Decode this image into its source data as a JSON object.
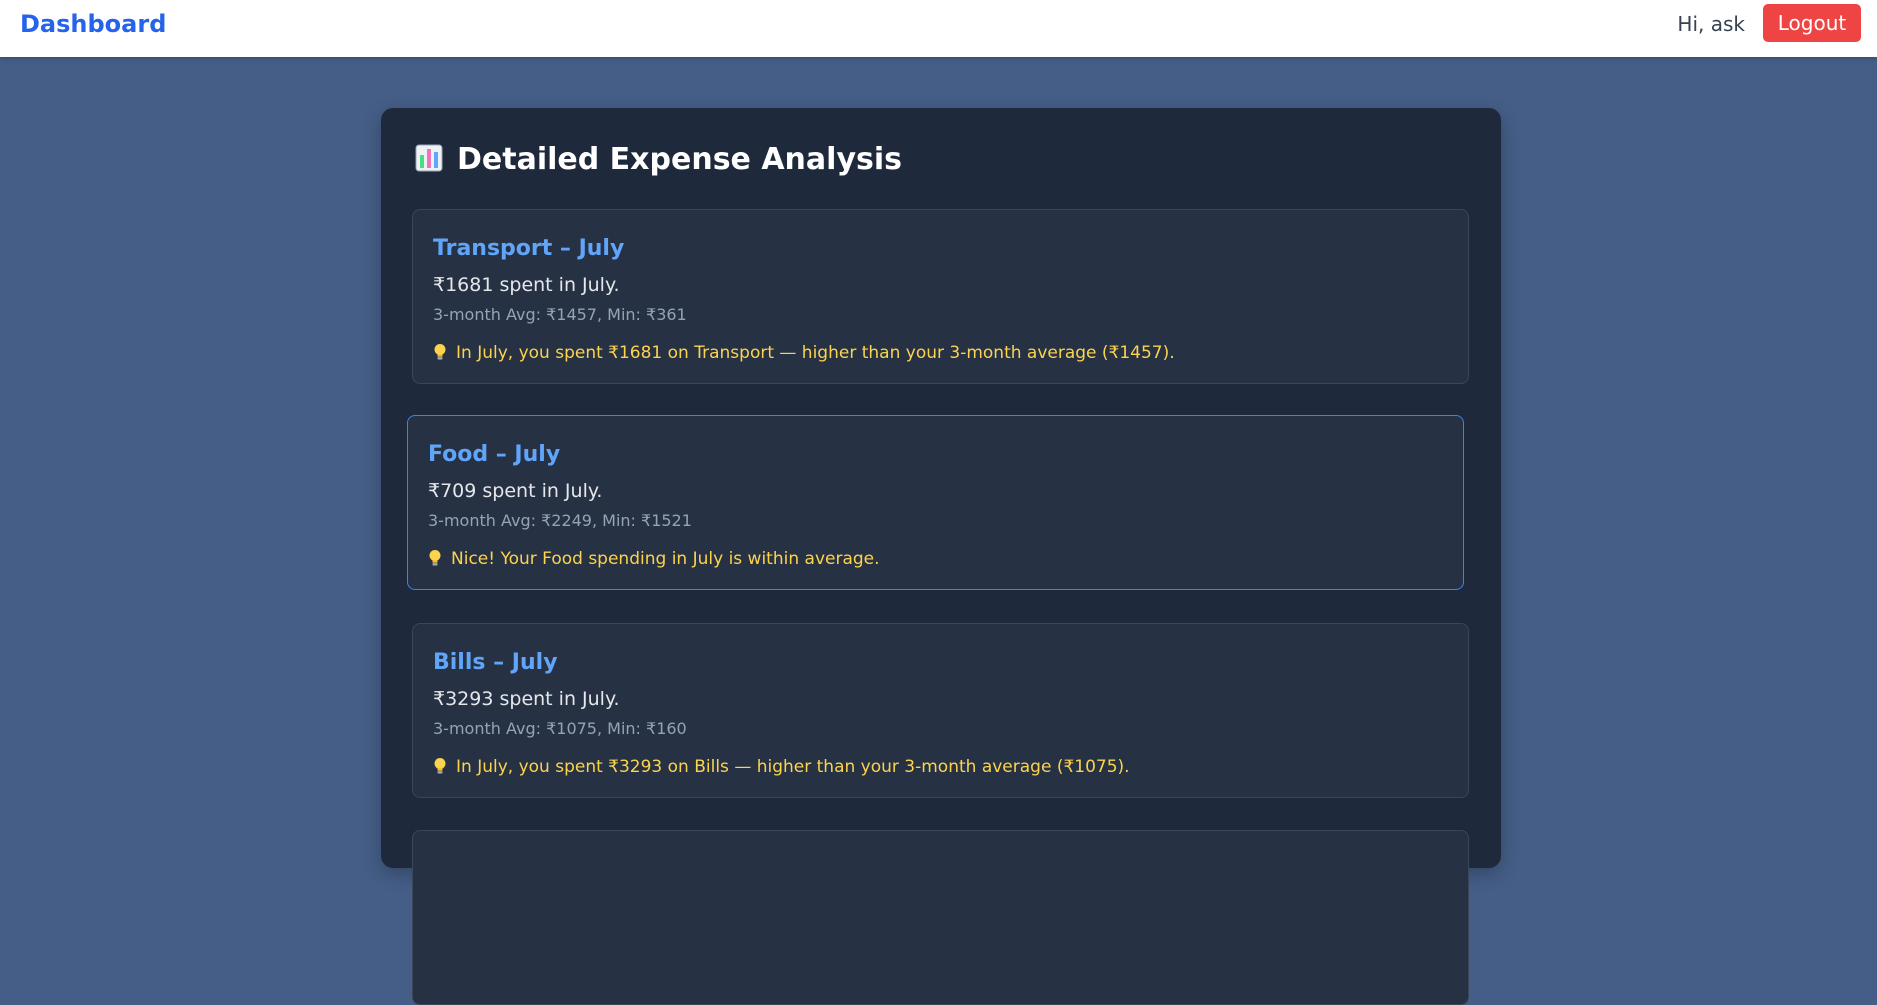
{
  "navbar": {
    "brand": "Dashboard",
    "greeting": "Hi, ask",
    "logout_label": "Logout"
  },
  "page": {
    "title_icon": "bar-chart-icon",
    "title": "Detailed Expense Analysis"
  },
  "cards": [
    {
      "title": "Transport – July",
      "spent": "₹1681 spent in July.",
      "stats": "3-month Avg: ₹1457, Min: ₹361",
      "insight_icon": "lightbulb-icon",
      "insight": "In July, you spent ₹1681 on Transport — higher than your 3-month average (₹1457)."
    },
    {
      "title": "Food – July",
      "spent": "₹709 spent in July.",
      "stats": "3-month Avg: ₹2249, Min: ₹1521",
      "insight_icon": "lightbulb-icon",
      "insight": "Nice! Your Food spending in July is within average."
    },
    {
      "title": "Bills – July",
      "spent": "₹3293 spent in July.",
      "stats": "3-month Avg: ₹1075, Min: ₹160",
      "insight_icon": "lightbulb-icon",
      "insight": "In July, you spent ₹3293 on Bills — higher than your 3-month average (₹1075)."
    }
  ],
  "colors": {
    "background": "#455e87",
    "panel": "#1e293b",
    "card": "#263244",
    "accent": "#60a5fa",
    "brand": "#2563eb",
    "logout": "#ef4444",
    "insight": "#fcd34d"
  }
}
